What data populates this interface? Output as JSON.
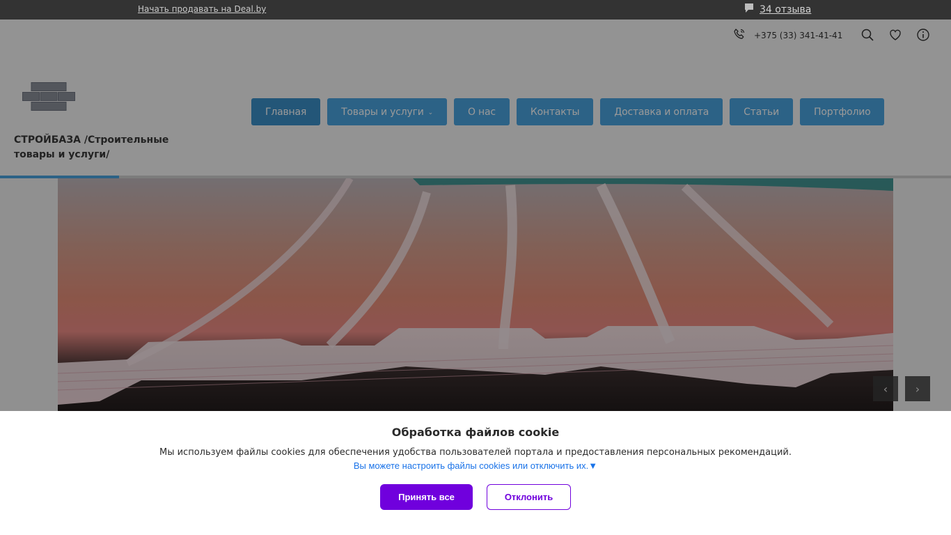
{
  "topbar": {
    "sell_link": "Начать продавать на Deal.by",
    "reviews_text": "34 отзыва"
  },
  "header": {
    "phone": "+375 (33) 341-41-41",
    "company_name": "СТРОЙБАЗА /Строительные товары и услуги/",
    "nav": [
      {
        "label": "Главная"
      },
      {
        "label": "Товары и услуги"
      },
      {
        "label": "О нас"
      },
      {
        "label": "Контакты"
      },
      {
        "label": "Доставка и оплата"
      },
      {
        "label": "Статьи"
      },
      {
        "label": "Портфолио"
      }
    ]
  },
  "cookie": {
    "title": "Обработка файлов cookie",
    "text": "Мы используем файлы cookies для обеспечения удобства пользователей портала и предоставления персональных рекомендаций.",
    "settings_link": "Вы можете настроить файлы cookies или отключить их.▼",
    "accept_label": "Принять все",
    "decline_label": "Отклонить"
  },
  "colors": {
    "accent_blue": "#4aa3df",
    "cookie_purple": "#7000dd",
    "topbar_bg": "#333333"
  }
}
